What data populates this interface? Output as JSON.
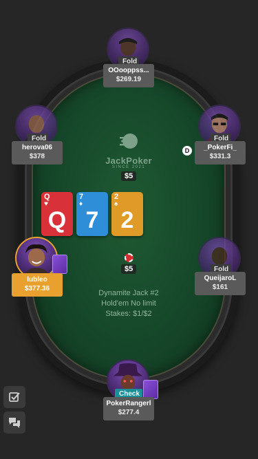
{
  "table": {
    "logo_name": "JackPoker",
    "logo_sub": "SINCE 2021",
    "pot_top": "$5",
    "pot_bottom": "$5",
    "info_line1": "Dynamite Jack #2",
    "info_line2": "Hold'em No limit",
    "info_line3": "Stakes: $1/$2",
    "dealer_button": "D"
  },
  "community_cards": [
    {
      "rank": "Q",
      "suit": "♥",
      "color": "#d9313a"
    },
    {
      "rank": "7",
      "suit": "♦",
      "color": "#2e8fd8"
    },
    {
      "rank": "2",
      "suit": "♠",
      "color": "#df9a28"
    }
  ],
  "players": {
    "top": {
      "name": "OOooppss...",
      "stack": "$269.19",
      "status": "Fold"
    },
    "left_upper": {
      "name": "herova06",
      "stack": "$378",
      "status": "Fold"
    },
    "right_upper": {
      "name": "_PokerFi_",
      "stack": "$331.3",
      "status": "Fold"
    },
    "left_lower": {
      "name": "lubleo",
      "stack": "$377.36",
      "status": ""
    },
    "right_lower": {
      "name": "QueijaroL",
      "stack": "$161",
      "status": "Fold"
    },
    "bottom": {
      "name": "PokerRangerl",
      "stack": "$277.4",
      "status": "Check"
    }
  },
  "icons": {
    "side_top": "checklist-icon",
    "side_bottom": "chat-icon"
  },
  "colors": {
    "felt": "#16472a",
    "active_player": "#e8a12e",
    "check_badge": "#1b8f95",
    "background": "#262626"
  }
}
